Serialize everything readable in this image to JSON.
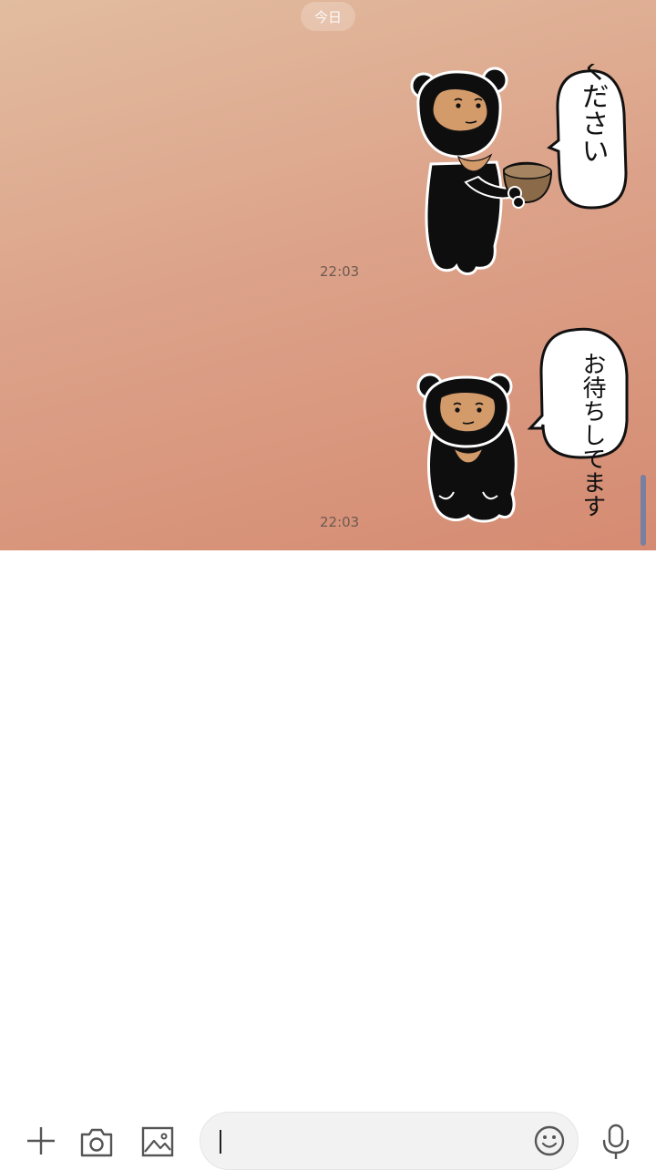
{
  "chat": {
    "date_label": "今日",
    "messages": [
      {
        "type": "sticker",
        "sticker": "bear-offering-bowl-sticker",
        "speech": "ください",
        "time": "22:03"
      },
      {
        "type": "sticker",
        "sticker": "bear-sitting-waiting-sticker",
        "speech": "お待ちしてます",
        "time": "22:03"
      }
    ]
  },
  "input_bar": {
    "add_icon": "plus-icon",
    "camera_icon": "camera-icon",
    "gallery_icon": "image-icon",
    "input_value": "",
    "emoji_icon": "emoji-icon",
    "mic_icon": "microphone-icon"
  },
  "colors": {
    "chat_top": "#e2bc9f",
    "chat_bottom": "#d58b72",
    "bear": "#0e0e0e",
    "bear_face": "#d39a6a",
    "bowl": "#8a6a48",
    "icon": "#555555"
  }
}
